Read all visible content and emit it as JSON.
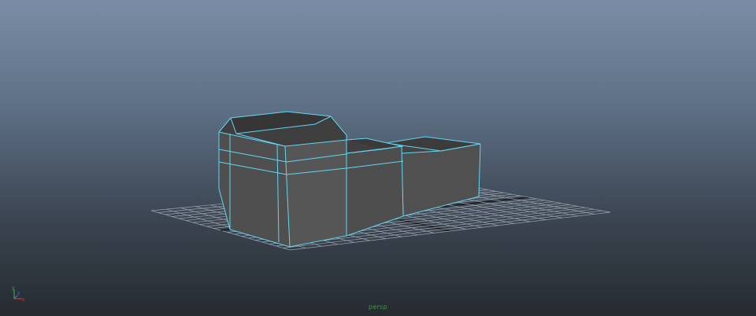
{
  "viewport": {
    "camera_name": "persp",
    "view_type": "perspective"
  },
  "axis_gizmo": {
    "labels": {
      "x": "x",
      "y": "y",
      "z": "z"
    },
    "colors": {
      "x": "#c23a3a",
      "y": "#3aa83a",
      "z": "#4a78d8"
    }
  },
  "grid": {
    "line_color": "#9aa3ad",
    "axis_color": "#1a1a1a"
  },
  "selection": {
    "wireframe_color": "#62d6f2",
    "mesh_color": "#4c4c4c",
    "mesh_top_color": "#3d3d3d",
    "mesh_side_color": "#555555"
  }
}
